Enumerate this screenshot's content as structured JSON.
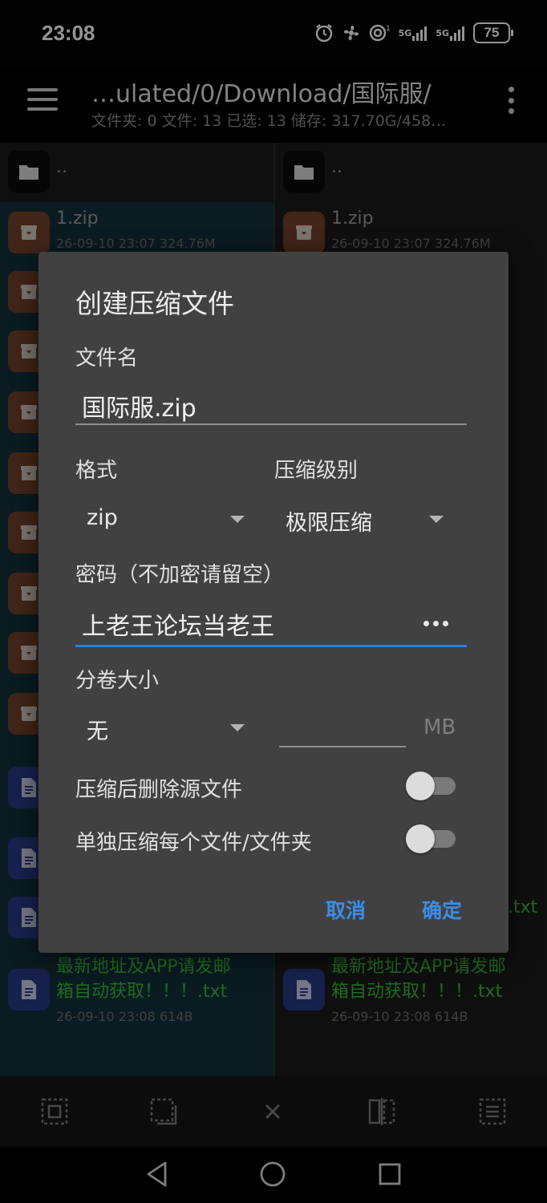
{
  "status": {
    "time": "23:08",
    "signal1": "5G",
    "signal2": "5G",
    "battery": "75"
  },
  "toolbar": {
    "path": "…ulated/0/Download/国际服/",
    "summary": "文件夹: 0  文件: 13  已选: 13  储存: 317.70G/458…"
  },
  "left_pane": {
    "parent": "..",
    "files": [
      {
        "name": "1.zip",
        "meta": "26-09-10 23:07  324.76M"
      }
    ],
    "bottom_file": {
      "name_line1": "最新地址及APP请发邮",
      "name_line2": "箱自动获取！！！.txt",
      "meta": "26-09-10 23:08  614B"
    }
  },
  "right_pane": {
    "parent": "..",
    "files": [
      {
        "name": "1.zip",
        "meta": "26-09-10 23:07  324.76M"
      }
    ],
    "peek_text": ".txt",
    "bottom_file": {
      "name_line1": "最新地址及APP请发邮",
      "name_line2": "箱自动获取！！！.txt",
      "meta": "26-09-10 23:08  614B"
    }
  },
  "dialog": {
    "title": "创建压缩文件",
    "filename_label": "文件名",
    "filename_value": "国际服.zip",
    "format_label": "格式",
    "format_value": "zip",
    "level_label": "压缩级别",
    "level_value": "极限压缩",
    "password_label": "密码（不加密请留空）",
    "password_value": "上老王论坛当老王",
    "split_label": "分卷大小",
    "split_value": "无",
    "split_unit": "MB",
    "delete_source_label": "压缩后删除源文件",
    "delete_source_on": false,
    "separate_label": "单独压缩每个文件/文件夹",
    "separate_on": false,
    "cancel_label": "取消",
    "ok_label": "确定"
  },
  "colors": {
    "accent": "#3a8ee6",
    "dialog_bg": "#414141",
    "green_text": "#38b838"
  }
}
